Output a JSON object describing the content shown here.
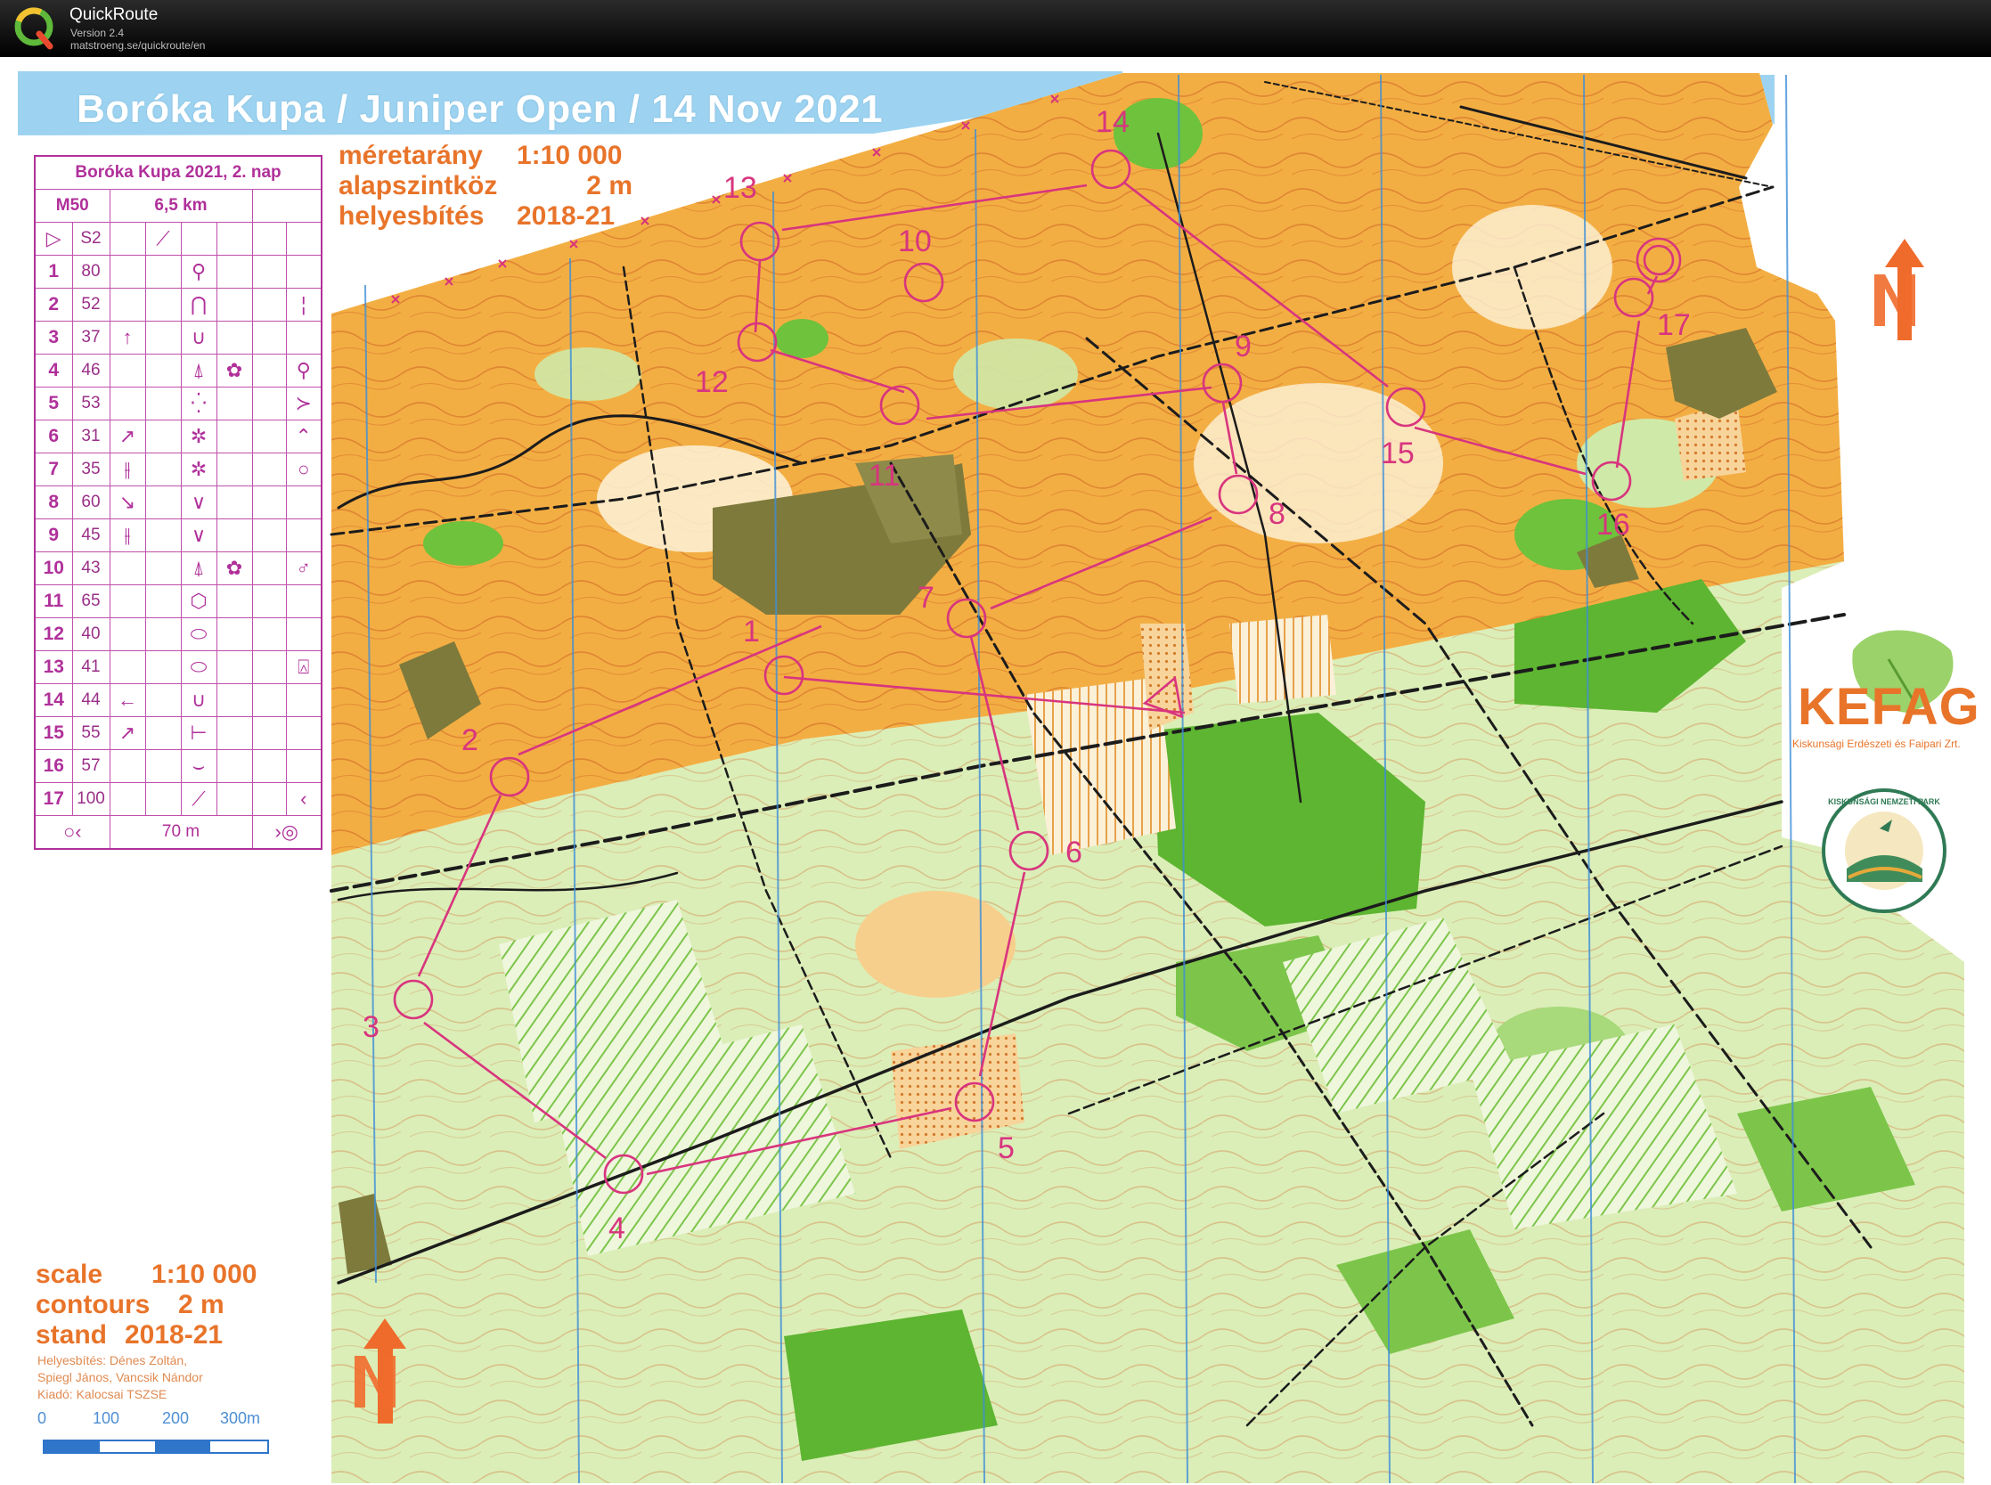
{
  "app": {
    "name": "QuickRoute",
    "version": "Version 2.4",
    "url": "matstroeng.se/quickroute/en",
    "logo_icon": "quickroute-q-icon"
  },
  "map": {
    "title": "Boróka Kupa / Juniper Open / 14 Nov 2021",
    "info_hu": [
      {
        "k": "méretarány",
        "v": "1:10 000"
      },
      {
        "k": "alapszintköz",
        "v": "2 m"
      },
      {
        "k": "helyesbítés",
        "v": "2018-21"
      }
    ],
    "info_en": [
      {
        "k": "scale",
        "v": "1:10 000"
      },
      {
        "k": "contours",
        "v": "2 m"
      },
      {
        "k": "stand",
        "v": "2018-21"
      }
    ],
    "credits": [
      "Helyesbítés: Dénes Zoltán,",
      "Spiegl János, Vancsik Nándor",
      "Kiadó: Kalocsai TSZSE"
    ],
    "scale_bar_labels": [
      "0",
      "100",
      "200",
      "300m"
    ],
    "colors": {
      "course": "#d8357e",
      "open_land": "#f4ad3c",
      "forest_green": "#6ec23c",
      "light_green": "#c6e6a0",
      "built_up": "#7e7a3c",
      "water_blue": "#8ecbef",
      "contour": "#c8632a"
    }
  },
  "control_descriptions": {
    "title": "Boróka Kupa 2021, 2. nap",
    "class": "M50",
    "length": "6,5 km",
    "start": {
      "num": "",
      "code": "S2"
    },
    "controls": [
      {
        "num": "1",
        "code": "80"
      },
      {
        "num": "2",
        "code": "52"
      },
      {
        "num": "3",
        "code": "37"
      },
      {
        "num": "4",
        "code": "46"
      },
      {
        "num": "5",
        "code": "53"
      },
      {
        "num": "6",
        "code": "31"
      },
      {
        "num": "7",
        "code": "35"
      },
      {
        "num": "8",
        "code": "60"
      },
      {
        "num": "9",
        "code": "45"
      },
      {
        "num": "10",
        "code": "43"
      },
      {
        "num": "11",
        "code": "65"
      },
      {
        "num": "12",
        "code": "40"
      },
      {
        "num": "13",
        "code": "41"
      },
      {
        "num": "14",
        "code": "44"
      },
      {
        "num": "15",
        "code": "55"
      },
      {
        "num": "16",
        "code": "57"
      },
      {
        "num": "17",
        "code": "100"
      }
    ],
    "finish": "70 m"
  },
  "course_labels": [
    "1",
    "2",
    "3",
    "4",
    "5",
    "6",
    "7",
    "8",
    "9",
    "10",
    "11",
    "12",
    "13",
    "14",
    "15",
    "16",
    "17"
  ],
  "sponsors": {
    "kefag_name": "KEFAG",
    "kefag_subtitle": "Kiskunsági Erdészeti és Faipari Zrt.",
    "park_name": "KISKUNSÁGI NEMZETI PARK"
  },
  "north_arrow_letter": "N"
}
